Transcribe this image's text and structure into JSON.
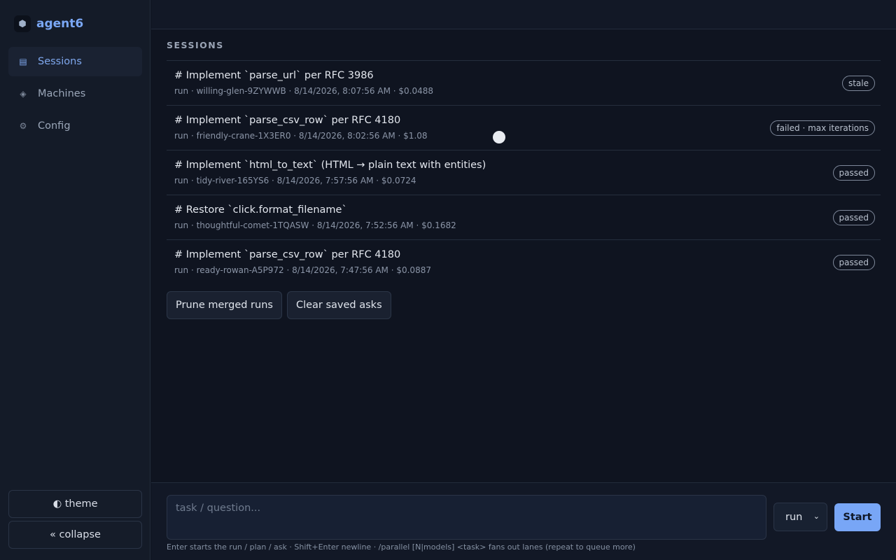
{
  "brand": {
    "name": "agent6",
    "logo_icon": "hexagon-icon"
  },
  "sidebar": {
    "items": [
      {
        "label": "Sessions",
        "icon": "list-icon",
        "active": true
      },
      {
        "label": "Machines",
        "icon": "diamond-icon",
        "active": false
      },
      {
        "label": "Config",
        "icon": "gear-icon",
        "active": false
      }
    ],
    "theme_label": "◐ theme",
    "collapse_label": "« collapse"
  },
  "sessions": {
    "heading": "SESSIONS",
    "items": [
      {
        "title": "# Implement `parse_url` per RFC 3986",
        "meta": "run · willing-glen-9ZYWWB · 8/14/2026, 8:07:56 AM · $0.0488",
        "status": "stale"
      },
      {
        "title": "# Implement `parse_csv_row` per RFC 4180",
        "meta": "run · friendly-crane-1X3ER0 · 8/14/2026, 8:02:56 AM · $1.08",
        "status": "failed · max iterations"
      },
      {
        "title": "# Implement `html_to_text` (HTML → plain text with entities)",
        "meta": "run · tidy-river-165YS6 · 8/14/2026, 7:57:56 AM · $0.0724",
        "status": "passed"
      },
      {
        "title": "# Restore `click.format_filename`",
        "meta": "run · thoughtful-comet-1TQASW · 8/14/2026, 7:52:56 AM · $0.1682",
        "status": "passed"
      },
      {
        "title": "# Implement `parse_csv_row` per RFC 4180",
        "meta": "run · ready-rowan-A5P972 · 8/14/2026, 7:47:56 AM · $0.0887",
        "status": "passed"
      }
    ],
    "actions": {
      "prune_label": "Prune merged runs",
      "clear_label": "Clear saved asks"
    }
  },
  "composer": {
    "placeholder": "task / question...",
    "mode_value": "run",
    "start_label": "Start",
    "hint": "Enter starts the run / plan / ask · Shift+Enter newline · /parallel [N|models] <task> fans out lanes (repeat to queue more)"
  },
  "colors": {
    "accent": "#78a6f6",
    "background": "#0f1420",
    "sidebar": "#141b28"
  }
}
